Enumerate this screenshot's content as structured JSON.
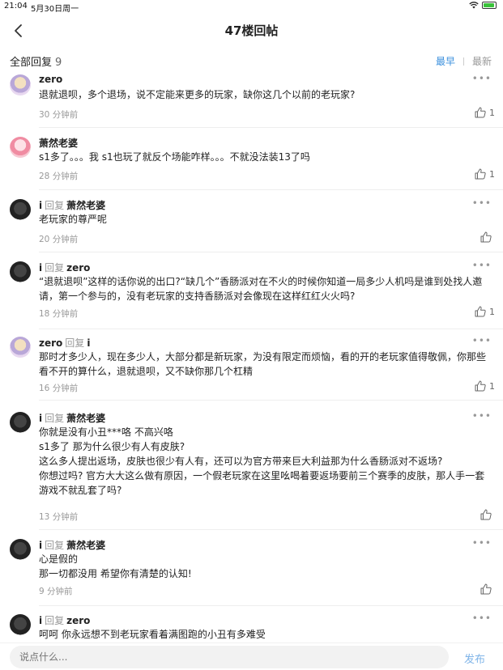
{
  "status": {
    "time": "21:04",
    "date": "5月30日周一"
  },
  "nav": {
    "title": "47楼回帖"
  },
  "replies": {
    "label": "全部回复",
    "count": "9",
    "sort_earliest": "最早",
    "sort_latest": "最新"
  },
  "items": [
    {
      "name": "zero",
      "reply_word": "",
      "target": "",
      "text": "退就退呗，多个退场，说不定能来更多的玩家，缺你这几个以前的老玩家?",
      "time": "30 分钟前",
      "likes": "1"
    },
    {
      "name": "萧然老婆",
      "reply_word": "",
      "target": "",
      "text": "s1多了。。。我 s1也玩了就反个场能咋样。。。不就没法装13了吗",
      "time": "28 分钟前",
      "likes": "1"
    },
    {
      "name": "i",
      "reply_word": "回复",
      "target": "萧然老婆",
      "text": "老玩家的尊严呢",
      "time": "20 分钟前",
      "likes": ""
    },
    {
      "name": "i",
      "reply_word": "回复",
      "target": "zero",
      "text": "“退就退呗”这样的话你说的出口?“缺几个”香肠派对在不火的时候你知道一局多少人机吗是谁到处找人邀请，第一个参与的，没有老玩家的支持香肠派对会像现在这样红红火火吗?",
      "time": "18 分钟前",
      "likes": "1"
    },
    {
      "name": "zero",
      "reply_word": "回复",
      "target": "i",
      "text": "那时才多少人，现在多少人，大部分都是新玩家，为没有限定而烦恼，看的开的老玩家值得敬佩，你那些看不开的算什么，退就退呗，又不缺你那几个杠精",
      "time": "16 分钟前",
      "likes": "1"
    },
    {
      "name": "i",
      "reply_word": "回复",
      "target": "萧然老婆",
      "lines": [
        "你就是没有小丑***咯 不高兴咯",
        "s1多了 那为什么很少有人有皮肤?",
        "这么多人提出返场，皮肤也很少有人有，还可以为官方带来巨大利益那为什么香肠派对不返场?",
        "你想过吗? 官方大大这么做有原因，一个假老玩家在这里吆喝着要返场要前三个赛季的皮肤，那人手一套",
        "游戏不就乱套了吗?"
      ],
      "time": "13 分钟前",
      "likes": ""
    },
    {
      "name": "i",
      "reply_word": "回复",
      "target": "萧然老婆",
      "lines": [
        "心是假的",
        "那一切都没用 希望你有清楚的认知!"
      ],
      "time": "9 分钟前",
      "likes": ""
    },
    {
      "name": "i",
      "reply_word": "回复",
      "target": "zero",
      "text": "呵呵 你永远想不到老玩家看着满图跑的小丑有多难受",
      "time": "",
      "likes": ""
    }
  ],
  "composer": {
    "placeholder": "说点什么...",
    "send_label": "发布"
  },
  "icons": {
    "back": "chevron-left-icon",
    "more": "more-dots-icon",
    "like": "thumb-up-icon",
    "wifi": "wifi-icon",
    "battery": "battery-icon"
  },
  "colors": {
    "accent": "#3a8fdd",
    "send": "#7fb4e8",
    "muted": "#999999",
    "battery": "#3ac23a"
  }
}
